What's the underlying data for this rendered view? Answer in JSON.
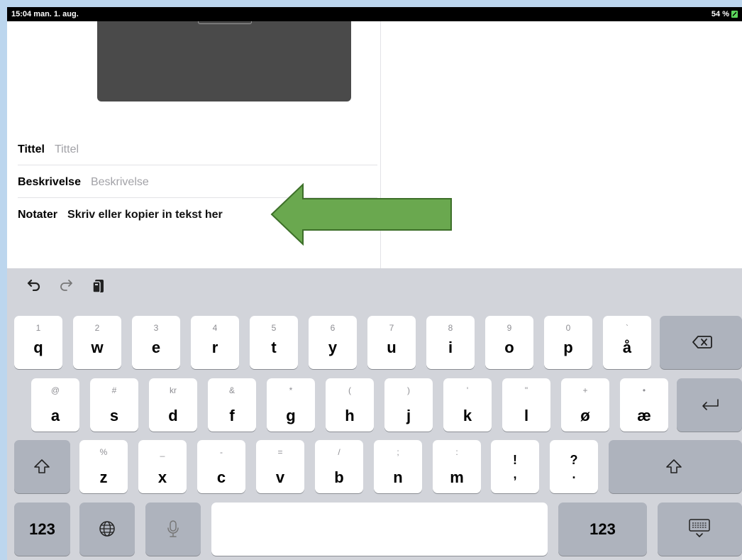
{
  "status": {
    "time": "15:04  man. 1. aug.",
    "battery": "54 %"
  },
  "form": {
    "title_label": "Tittel",
    "title_placeholder": "Tittel",
    "desc_label": "Beskrivelse",
    "desc_placeholder": "Beskrivelse",
    "notes_label": "Notater",
    "notes_value": "Skriv eller kopier in tekst her"
  },
  "toolbar": {
    "undo_icon": "undo-icon",
    "redo_icon": "redo-icon",
    "paste_icon": "paste-icon"
  },
  "keyboard": {
    "row1": [
      {
        "sub": "1",
        "main": "q"
      },
      {
        "sub": "2",
        "main": "w"
      },
      {
        "sub": "3",
        "main": "e"
      },
      {
        "sub": "4",
        "main": "r"
      },
      {
        "sub": "5",
        "main": "t"
      },
      {
        "sub": "6",
        "main": "y"
      },
      {
        "sub": "7",
        "main": "u"
      },
      {
        "sub": "8",
        "main": "i"
      },
      {
        "sub": "9",
        "main": "o"
      },
      {
        "sub": "0",
        "main": "p"
      },
      {
        "sub": "`",
        "main": "å"
      }
    ],
    "row2": [
      {
        "sub": "@",
        "main": "a"
      },
      {
        "sub": "#",
        "main": "s"
      },
      {
        "sub": "kr",
        "main": "d"
      },
      {
        "sub": "&",
        "main": "f"
      },
      {
        "sub": "*",
        "main": "g"
      },
      {
        "sub": "(",
        "main": "h"
      },
      {
        "sub": ")",
        "main": "j"
      },
      {
        "sub": "'",
        "main": "k"
      },
      {
        "sub": "\"",
        "main": "l"
      },
      {
        "sub": "+",
        "main": "ø"
      },
      {
        "sub": "•",
        "main": "æ"
      }
    ],
    "row3": [
      {
        "sub": "%",
        "main": "z"
      },
      {
        "sub": "_",
        "main": "x"
      },
      {
        "sub": "-",
        "main": "c"
      },
      {
        "sub": "=",
        "main": "v"
      },
      {
        "sub": "/",
        "main": "b"
      },
      {
        "sub": ";",
        "main": "n"
      },
      {
        "sub": ":",
        "main": "m"
      }
    ],
    "exclam": {
      "top": "!",
      "bot": ","
    },
    "question": {
      "top": "?",
      "bot": "."
    },
    "numbers_label": "123",
    "numbers_label_right": "123",
    "globe_icon": "globe-icon",
    "mic_icon": "mic-icon",
    "backspace_icon": "backspace-icon",
    "return_icon": "return-icon",
    "shift_icon": "shift-icon",
    "hide_keyboard_icon": "hide-keyboard-icon"
  }
}
